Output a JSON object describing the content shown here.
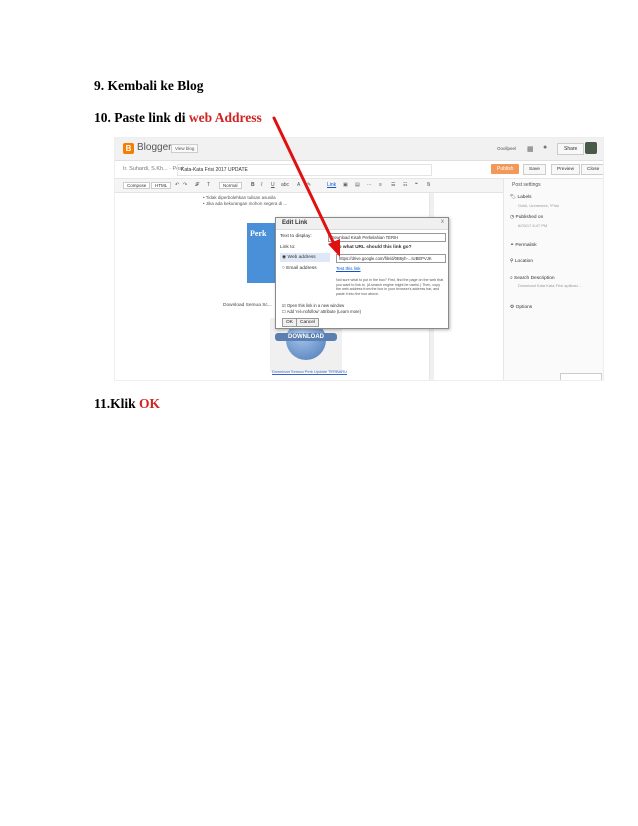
{
  "steps": {
    "s9": "9.  Kembali ke Blog",
    "s10_prefix": "10. Paste link di ",
    "s10_hl": "web Address",
    "s11_prefix": "11.Klik ",
    "s11_hl": "OK"
  },
  "colors": {
    "highlight": "#d32222",
    "arrow": "#e01010",
    "publish": "#f2995a"
  },
  "screenshot": {
    "logo": "B",
    "brand": "Blogger",
    "view_blog": "View blog",
    "account": "Ooollpeel",
    "share": "Share",
    "crumb": "Ir. Suhardi, S.Kh... · Post",
    "post_title": "Kata-Kata Frisi 2017 UPDATE",
    "publish": "Publish",
    "save": "Save",
    "preview": "Preview",
    "close": "Close",
    "compose": "Compose",
    "html": "HTML",
    "font": "Normal",
    "link": "Link",
    "post_settings": "Post settings",
    "settings": {
      "labels": "Labels",
      "labels_sub": "Gokil, Unmemes, *Frisi",
      "published": "Published on",
      "published_sub": "6/03/17 6:47 PM",
      "permalink": "Permalink",
      "location": "Location",
      "search_desc": "Search Description",
      "search_sub": "Download Kata Kata Frisi aplikasi ...",
      "options": "Options"
    },
    "editor": {
      "b1": "•  Tidak diperbolehkan tulisan asusila",
      "b2": "•  Jika ada kekurangan mohon segera di ...",
      "blue_text": "Perk",
      "caption": "Download Semua Sc...",
      "download": "DOWNLOAD",
      "dl_link": "Download Semua Perk Update TERBARU"
    },
    "dialog": {
      "title": "Edit Link",
      "x": "x",
      "text_label": "Text to display:",
      "text_value": "Download Kisah Perkelahian TERIH",
      "linkto": "Link to:",
      "q": "To what URL should this link go?",
      "web": "Web address",
      "email": "Email address",
      "url": "https://drive.google.com/file/d/0B6yh-...IUBEPVJK",
      "test": "Test this link",
      "help": "Not sure what to put in the box? First, find the page on the web that you want to link to. (A search engine might be useful.) Then, copy the web address from the box in your browser's address bar, and paste it into the box above.",
      "opt1": "Open this link in a new window",
      "opt2": "Add 'rel=nofollow' attribute (Learn more)",
      "ok": "OK",
      "cancel": "Cancel"
    }
  }
}
